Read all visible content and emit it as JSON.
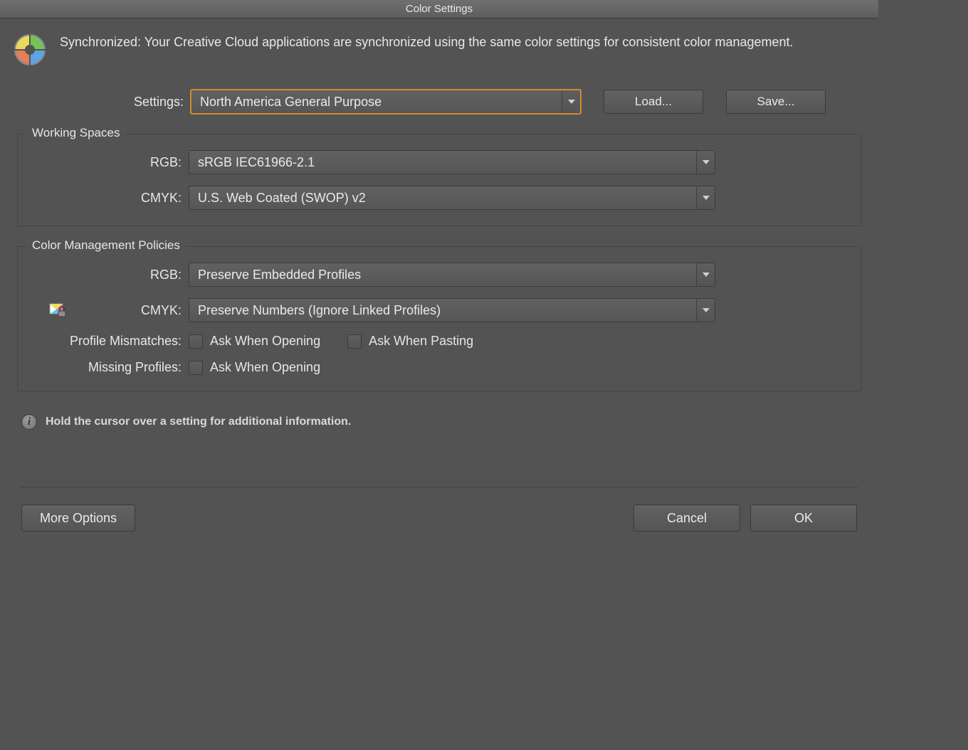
{
  "window": {
    "title": "Color Settings"
  },
  "sync": {
    "message": "Synchronized: Your Creative Cloud applications are synchronized using the same color settings for consistent color management."
  },
  "settings": {
    "label": "Settings:",
    "value": "North America General Purpose",
    "load_button": "Load...",
    "save_button": "Save..."
  },
  "working_spaces": {
    "legend": "Working Spaces",
    "rgb_label": "RGB:",
    "rgb_value": "sRGB IEC61966-2.1",
    "cmyk_label": "CMYK:",
    "cmyk_value": "U.S. Web Coated (SWOP) v2"
  },
  "policies": {
    "legend": "Color Management Policies",
    "rgb_label": "RGB:",
    "rgb_value": "Preserve Embedded Profiles",
    "cmyk_label": "CMYK:",
    "cmyk_value": "Preserve Numbers (Ignore Linked Profiles)",
    "profile_mismatches_label": "Profile Mismatches:",
    "ask_opening": "Ask When Opening",
    "ask_pasting": "Ask When Pasting",
    "missing_profiles_label": "Missing Profiles:"
  },
  "hint": "Hold the cursor over a setting for additional information.",
  "footer": {
    "more_options": "More Options",
    "cancel": "Cancel",
    "ok": "OK"
  }
}
